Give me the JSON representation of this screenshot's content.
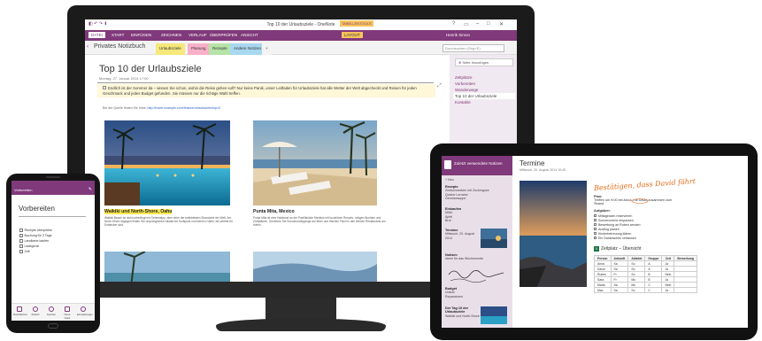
{
  "monitor": {
    "window_title": "Top 10 der Urlaubsziele - OneNote",
    "tool_tab_header": "TABELLENTOOLS",
    "user": "Henrik Simon",
    "ribbon_tabs": [
      "DATEI",
      "START",
      "EINFÜGEN",
      "ZEICHNEN",
      "VERLAUF",
      "ÜBERPRÜFEN",
      "ANSICHT",
      "LAYOUT"
    ],
    "notebook_name": "Privates Notizbuch",
    "section_tabs": [
      {
        "label": "Urlaubsziele",
        "color": "#f6e87a"
      },
      {
        "label": "Planung",
        "color": "#f8b0c8"
      },
      {
        "label": "Rezepte",
        "color": "#b6e3a8"
      },
      {
        "label": "Andere Notizen",
        "color": "#a8d8ef"
      },
      {
        "label": "+",
        "color": "#f3f3f3"
      }
    ],
    "search_placeholder": "Durchsuchen (Strg+E)",
    "new_page_label": "Seite hinzufügen",
    "pages": [
      "Zeltplätze",
      "Vorbereiten",
      "Wanderwege",
      "Top 10 der Urlaubsziele",
      "Kontakte"
    ],
    "selected_page_index": 3,
    "page_title": "Top 10 der Urlaubsziele",
    "page_date": "Montag, 27. Januar 2014      17:00",
    "intro": "Endlich ist der Sommer da – wissen Sie schon, wohin die Reise gehen soll? Nur keine Panik, unser Leitfaden für Urlaubsziele hat alle Wetter der Welt abgecheckt und Reisen für jeden Geschmack und jedes Budget gefunden. Sie müssen nur die richtige Wahl treffen.",
    "source_line": "Bei der Quelle finden Sie Infos:",
    "source_url": "http://travel.example.com/feature/urlaubsziele/top10",
    "captions": {
      "left": "Waikiki und North-Shore, Oahu",
      "right": "Punta Mita, Mexico"
    },
    "paragraph_left": "Waikiki Beach ist nicht unbedingt ein Geheimtipp, aber einer der beliebtesten Strandorte der Welt. Am North-Shore dagegen finden Sie ursprüngliches Hawaii mit Surfspots und kleinen Cafés, die perfekt für Entdecker sind.",
    "paragraph_right": "Punta Mita ist eine Halbinsel an der Pazifikküste Mexikos mit luxuriösen Resorts, ruhigen Buchten und Golfplätzen. Genießen Sie Sonnenuntergänge am Meer und frischen Fisch in den kleinen Restaurants am Hafen."
  },
  "tablet": {
    "pane_header": "Zuletzt verwendete Notizen",
    "new_label": "+ Neu",
    "recent": [
      {
        "title": "Rezepte",
        "lines": [
          "Zimtschnecken mit Zuckerguss",
          "Quiche Lorraine",
          "Gemüsesuppe"
        ]
      },
      {
        "title": "Einkaufen",
        "lines": [
          "Milch",
          "Äpfel",
          "Brot"
        ]
      },
      {
        "title": "Termine",
        "lines": [
          "Mittwoch, 20. August 2014"
        ]
      },
      {
        "title": "Notizen",
        "lines": [
          "Ideen für das Wochenende"
        ]
      },
      {
        "title": "Budget",
        "lines": [
          "Urlaub",
          "Reparaturen"
        ]
      },
      {
        "title": "Der Tag 10 der Urlaubsziele",
        "lines": [
          "Waikiki und North-Shore"
        ]
      }
    ],
    "page_title": "Termine",
    "page_date": "Mittwoch, 20. August 2014    10:45",
    "handwriting": "Bestätigen, dass David fährt",
    "plan_label": "Plan:",
    "plan_text": "Treffen um 9:00 bei Anna, mit David zusammen zum Strand",
    "todo_label": "Aufgaben:",
    "todos": [
      "Mittagessen reservieren",
      "Sonnencreme einpacken",
      "Bewerbung an Ruben senden",
      "Ausflug planen",
      "Kinderbetreuung klären",
      "Ein Dankeschön verfassen"
    ],
    "table_title": "Zeltplatz – Übersicht",
    "table_headers": [
      "Person",
      "Ankunft",
      "Abfahrt",
      "Gruppe",
      "Zelt",
      "Bemerkung"
    ],
    "table_rows": [
      [
        "Anna",
        "Sa",
        "So",
        "A",
        "Ja",
        ""
      ],
      [
        "David",
        "Sa",
        "So",
        "A",
        "Ja",
        ""
      ],
      [
        "Ruben",
        "Fr",
        "So",
        "B",
        "Nein",
        ""
      ],
      [
        "Sara",
        "Fr",
        "Mo",
        "B",
        "Ja",
        ""
      ],
      [
        "Maria",
        "Sa",
        "Mo",
        "C",
        "Nein",
        ""
      ],
      [
        "Max",
        "Sa",
        "So",
        "C",
        "Ja",
        ""
      ]
    ]
  },
  "phone": {
    "bar_label": "Vorbereiten",
    "title": "Vorbereiten",
    "items": [
      "Rezepte überprüfen",
      "Buchung für 3 Tage",
      "Landkarte kaufen",
      "Ladegerät",
      "Zelt"
    ],
    "nav": [
      "Notizbücher",
      "Zuletzt",
      "Suchen",
      "Neue Notiz",
      "Einstellungen"
    ]
  },
  "colors": {
    "accent": "#80397b",
    "highlight": "#ffe94f"
  }
}
